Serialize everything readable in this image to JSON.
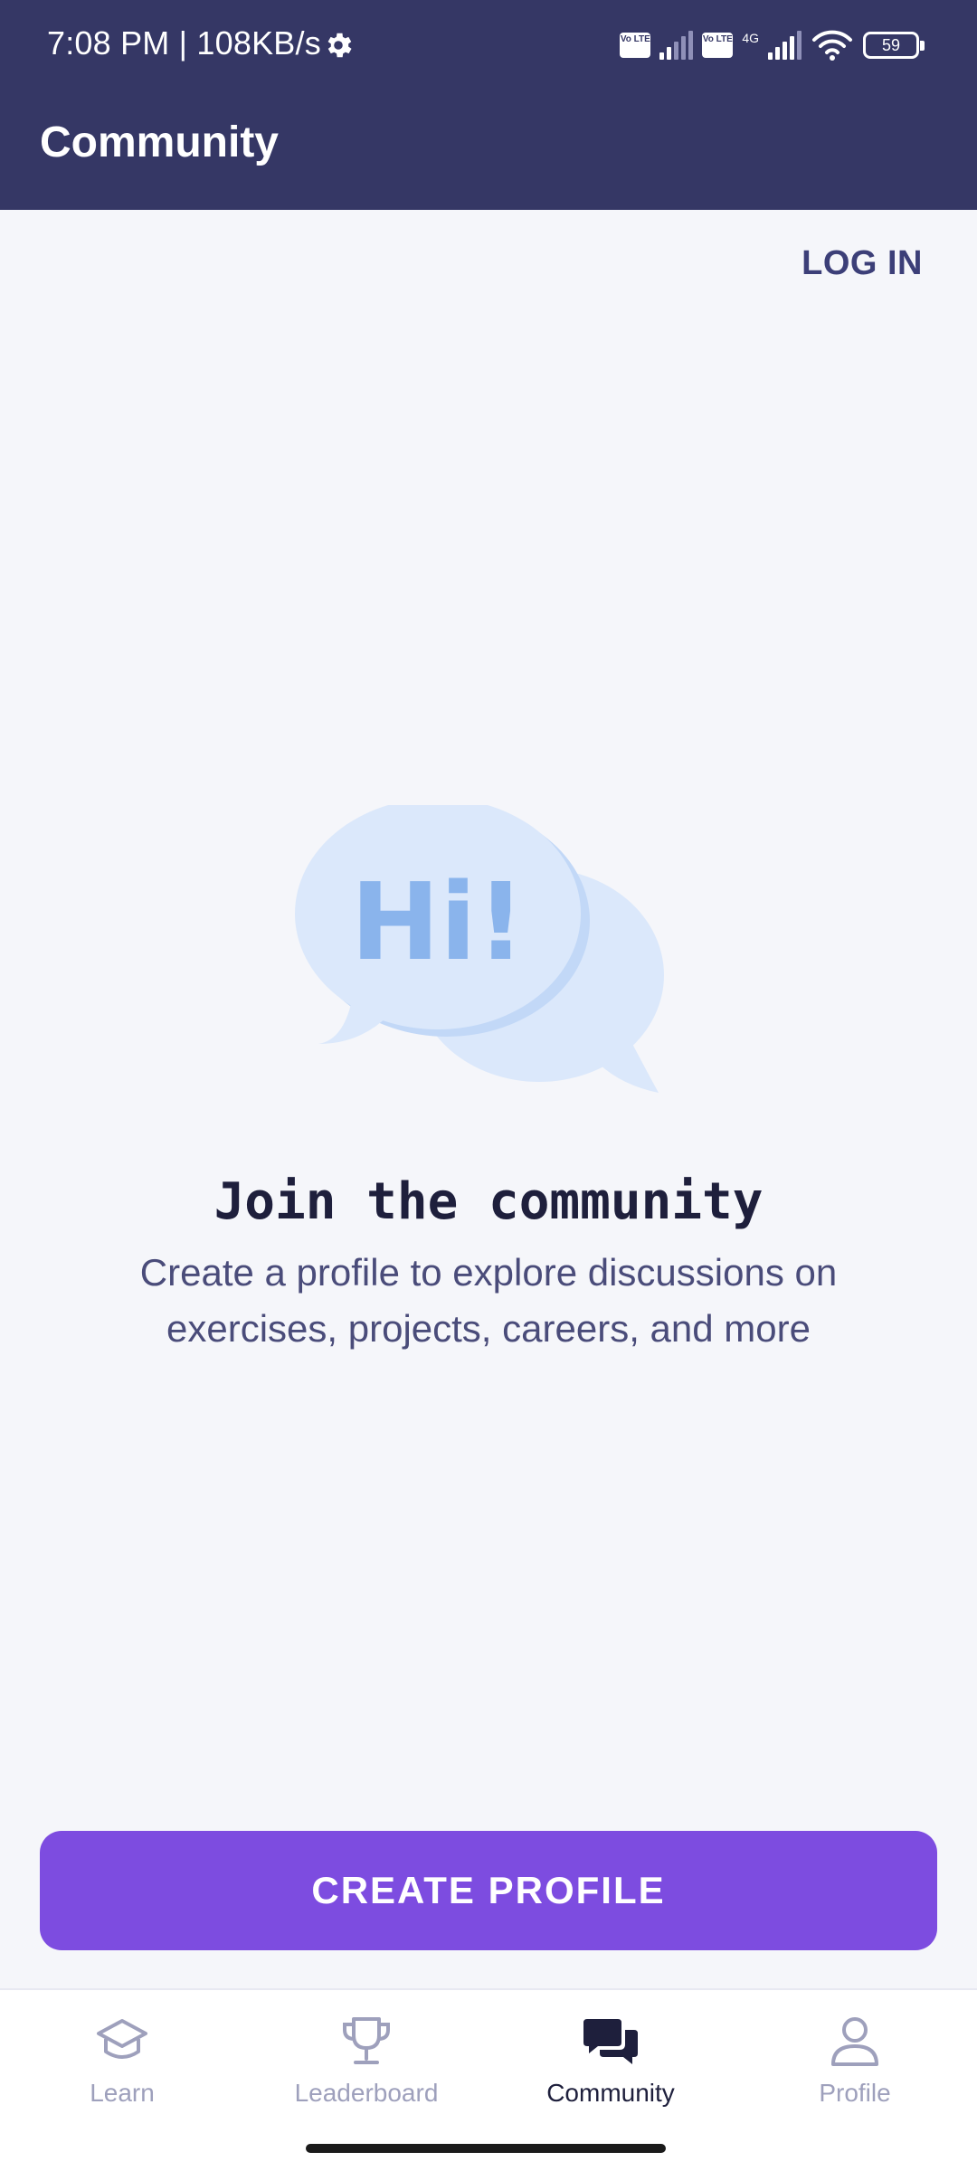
{
  "status_bar": {
    "time_speed": "7:08 PM | 108KB/s",
    "network_label": "4G",
    "volte_label": "Vo LTE",
    "battery": "59"
  },
  "app_bar": {
    "title": "Community"
  },
  "actions": {
    "login": "LOG IN"
  },
  "illustration": {
    "bubble_text": "Hi!"
  },
  "empty_state": {
    "headline": "Join the community",
    "description": "Create a profile to explore discussions on exercises, projects, careers, and more"
  },
  "cta": {
    "label": "CREATE PROFILE",
    "color": "#7d4ce0"
  },
  "bottom_nav": {
    "active": "Community",
    "items": [
      {
        "label": "Learn",
        "icon": "graduation-cap-icon"
      },
      {
        "label": "Leaderboard",
        "icon": "trophy-icon"
      },
      {
        "label": "Community",
        "icon": "chat-bubbles-icon"
      },
      {
        "label": "Profile",
        "icon": "person-icon"
      }
    ]
  },
  "colors": {
    "header": "#353765",
    "background": "#f5f6fa",
    "text_dark": "#1e1f3c"
  }
}
